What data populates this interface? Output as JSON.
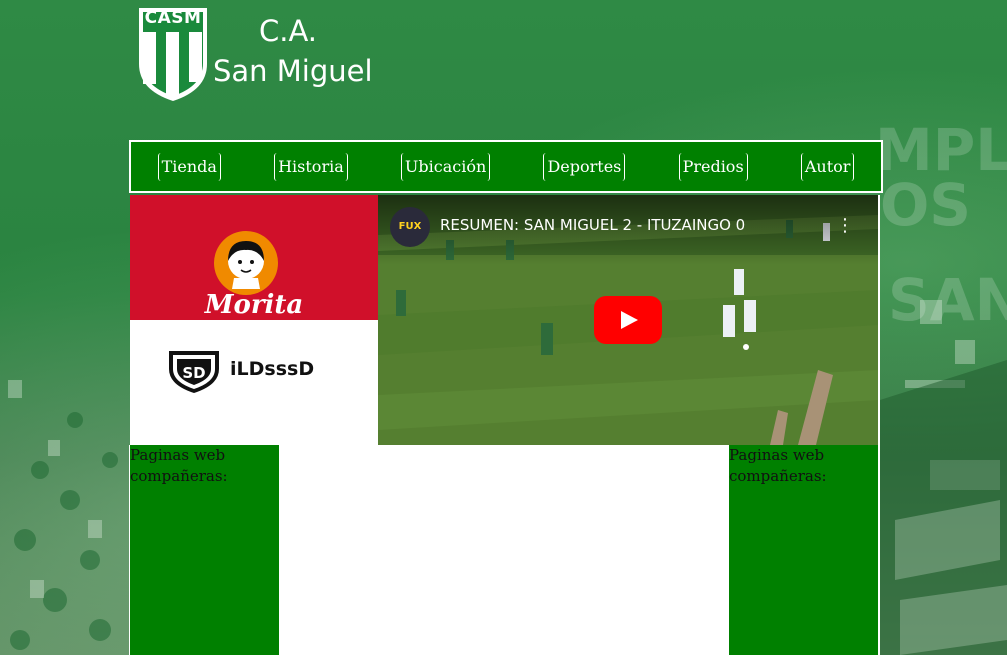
{
  "brand": {
    "abbr": "CASM",
    "name_line1": "C.A.",
    "name_line2": "San Miguel"
  },
  "nav": {
    "items": [
      {
        "label": "Tienda"
      },
      {
        "label": "Historia"
      },
      {
        "label": "Ubicación"
      },
      {
        "label": "Deportes"
      },
      {
        "label": "Predios"
      },
      {
        "label": "Autor"
      }
    ]
  },
  "sponsors": {
    "top_text": "Morita",
    "bottom_text": "iLDsssD"
  },
  "video": {
    "channel_badge": "FUX",
    "title": "RESUMEN: SAN MIGUEL 2 - ITUZAINGO 0",
    "menu_icon": "⋮"
  },
  "partners": {
    "left_label": "Paginas web compañeras:",
    "right_label": "Paginas web compañeras:"
  },
  "colors": {
    "nav_bg": "#008000",
    "sponsor_red": "#d0102a",
    "play_red": "#ff0000"
  }
}
